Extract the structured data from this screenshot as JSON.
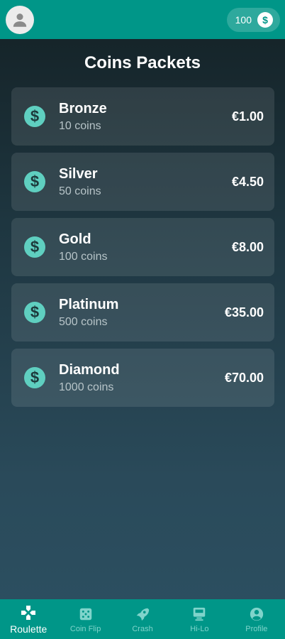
{
  "header": {
    "balance": "100",
    "coin_symbol": "$"
  },
  "page": {
    "title": "Coins Packets"
  },
  "packets": [
    {
      "name": "Bronze",
      "coins": "10 coins",
      "price": "€1.00",
      "icon": "dollar-coin-icon"
    },
    {
      "name": "Silver",
      "coins": "50 coins",
      "price": "€4.50",
      "icon": "dollar-coin-icon"
    },
    {
      "name": "Gold",
      "coins": "100 coins",
      "price": "€8.00",
      "icon": "dollar-coin-icon"
    },
    {
      "name": "Platinum",
      "coins": "500 coins",
      "price": "€35.00",
      "icon": "dollar-coin-icon"
    },
    {
      "name": "Diamond",
      "coins": "1000 coins",
      "price": "€70.00",
      "icon": "dollar-coin-icon"
    }
  ],
  "nav": {
    "items": [
      {
        "label": "Roulette",
        "icon": "gamepad-icon",
        "active": true
      },
      {
        "label": "Coin Flip",
        "icon": "dice-icon",
        "active": false
      },
      {
        "label": "Crash",
        "icon": "rocket-icon",
        "active": false
      },
      {
        "label": "Hi-Lo",
        "icon": "slot-machine-icon",
        "active": false
      },
      {
        "label": "Profile",
        "icon": "account-icon",
        "active": false
      }
    ]
  },
  "colors": {
    "accent": "#009688",
    "coin_icon": "#5fcfc0",
    "nav_inactive": "#7fd4cb"
  }
}
